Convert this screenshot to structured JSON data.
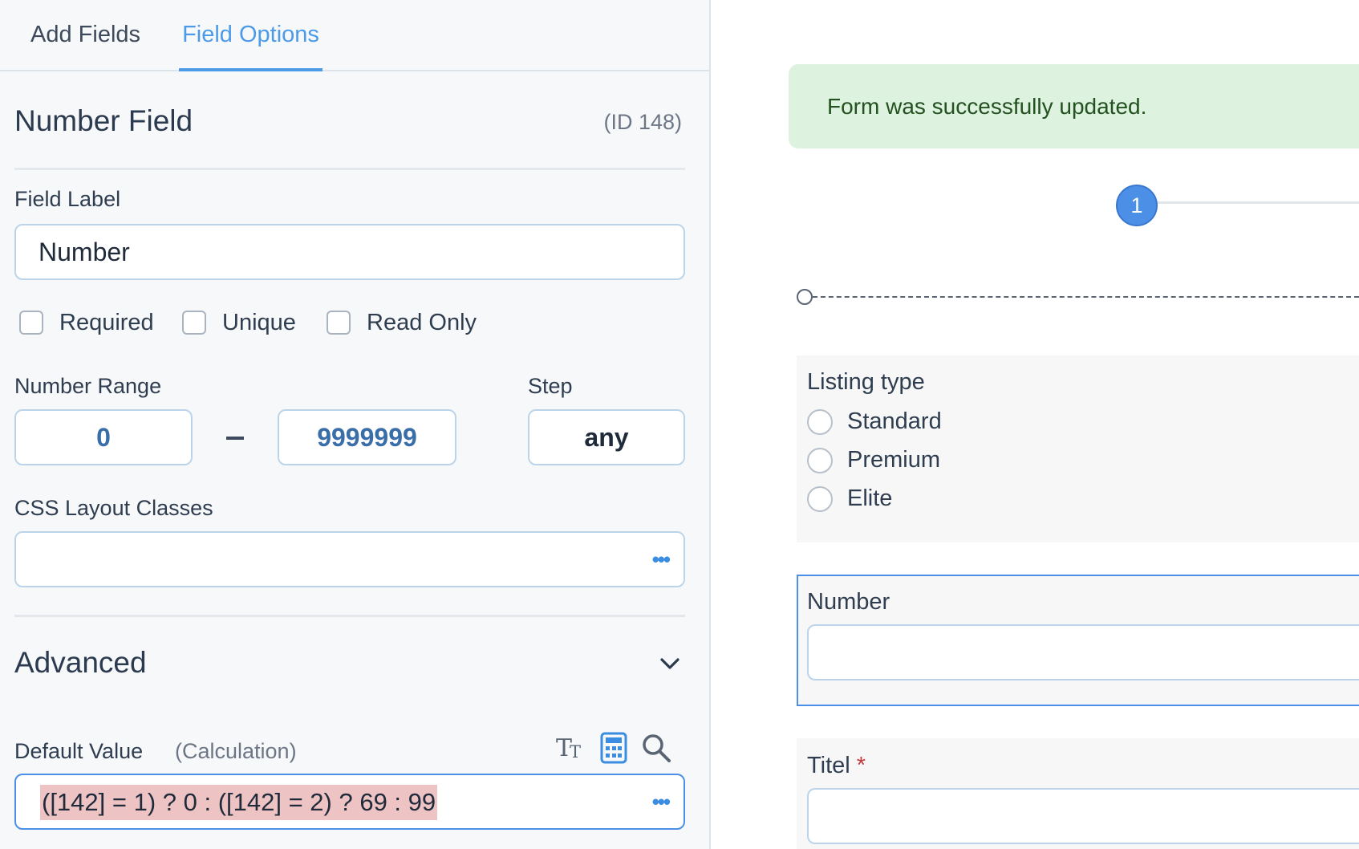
{
  "tabs": {
    "add_fields": "Add Fields",
    "field_options": "Field Options"
  },
  "field": {
    "title": "Number Field",
    "id": "(ID 148)"
  },
  "field_label": {
    "label": "Field Label",
    "value": "Number"
  },
  "checkboxes": {
    "required": "Required",
    "unique": "Unique",
    "read_only": "Read Only"
  },
  "range": {
    "label": "Number Range",
    "min": "0",
    "separator": "–",
    "max": "9999999"
  },
  "step": {
    "label": "Step",
    "value": "any"
  },
  "css_classes": {
    "label": "CSS Layout Classes",
    "value": "",
    "more": "•••"
  },
  "advanced": {
    "title": "Advanced"
  },
  "default_value": {
    "label": "Default Value",
    "type": "(Calculation)",
    "value": "([142] = 1) ? 0 : ([142] = 2) ? 69 : 99",
    "more": "•••",
    "icons": [
      "text-format-icon",
      "calculator-icon",
      "search-icon"
    ]
  },
  "preview": {
    "alert": "Form was successfully updated.",
    "step_number": "1",
    "listing": {
      "label": "Listing type",
      "options": [
        "Standard",
        "Premium",
        "Elite"
      ]
    },
    "number_label": "Number",
    "titel_label": "Titel",
    "required_mark": "*"
  },
  "colors": {
    "accent": "#4c9be8",
    "success_bg": "#def2e0",
    "success_text": "#23511f",
    "highlight": "#eec3c3"
  }
}
